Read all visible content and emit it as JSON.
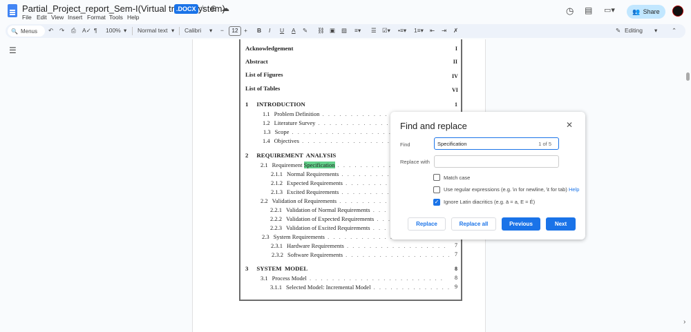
{
  "header": {
    "title": "Partial_Project_report_Sem-I(Virtual try on system)",
    "badge": ".DOCX",
    "menus": [
      "File",
      "Edit",
      "View",
      "Insert",
      "Format",
      "Tools",
      "Help"
    ],
    "share": "Share"
  },
  "toolbar": {
    "menus": "Menus",
    "zoom": "100%",
    "style": "Normal text",
    "font": "Calibri",
    "font_size": "12",
    "mode": "Editing"
  },
  "toc": [
    {
      "label": "Acknowledgement",
      "page": "I"
    },
    {
      "label": "Abstract",
      "page": "II"
    },
    {
      "label": "List of Figures",
      "page": "IV"
    },
    {
      "label": "List of Tables",
      "page": "VI"
    },
    {
      "num": "1",
      "label": "INTRODUCTION",
      "page": "1"
    },
    {
      "num": "1.1",
      "label": "Problem Definition"
    },
    {
      "num": "1.2",
      "label": "Literature Survey"
    },
    {
      "num": "1.3",
      "label": "Scope"
    },
    {
      "num": "1.4",
      "label": "Objectives"
    },
    {
      "num": "2",
      "label": "REQUIREMENT  ANALYSIS"
    },
    {
      "num": "2.1",
      "label": "Requirement ",
      "highlight": "Specification"
    },
    {
      "num": "2.1.1",
      "label": "Normal Requirements"
    },
    {
      "num": "2.1.2",
      "label": "Expected Requirements"
    },
    {
      "num": "2.1.3",
      "label": "Excited Requirements"
    },
    {
      "num": "2.2",
      "label": "Validation of Requirements"
    },
    {
      "num": "2.2.1",
      "label": "Validation of Normal Requirements"
    },
    {
      "num": "2.2.2",
      "label": "Validation of Expected Requirements"
    },
    {
      "num": "2.2.3",
      "label": "Validation of Excited Requirements"
    },
    {
      "num": "2.3",
      "label": "System Requirements"
    },
    {
      "num": "2.3.1",
      "label": "Hardware Requirements",
      "page": "7"
    },
    {
      "num": "2.3.2",
      "label": "Software Requirements",
      "page": "7"
    },
    {
      "num": "3",
      "label": "SYSTEM  MODEL",
      "page": "8"
    },
    {
      "num": "3.1",
      "label": "Process Model",
      "page": "8"
    },
    {
      "num": "3.1.1",
      "label": "Selected Model: Incremental Model",
      "page": "9"
    }
  ],
  "dialog": {
    "title": "Find and replace",
    "find_label": "Find",
    "find_value": "Specification",
    "count": "1 of 5",
    "replace_label": "Replace with",
    "replace_value": "",
    "match_case": "Match case",
    "regex": "Use regular expressions (e.g. \\n for newline, \\t for tab)",
    "help": "Help",
    "diacritics": "Ignore Latin diacritics (e.g. ä = a, E = É)",
    "replace": "Replace",
    "replace_all": "Replace all",
    "previous": "Previous",
    "next": "Next",
    "checked": {
      "match_case": false,
      "regex": false,
      "diacritics": true
    }
  }
}
